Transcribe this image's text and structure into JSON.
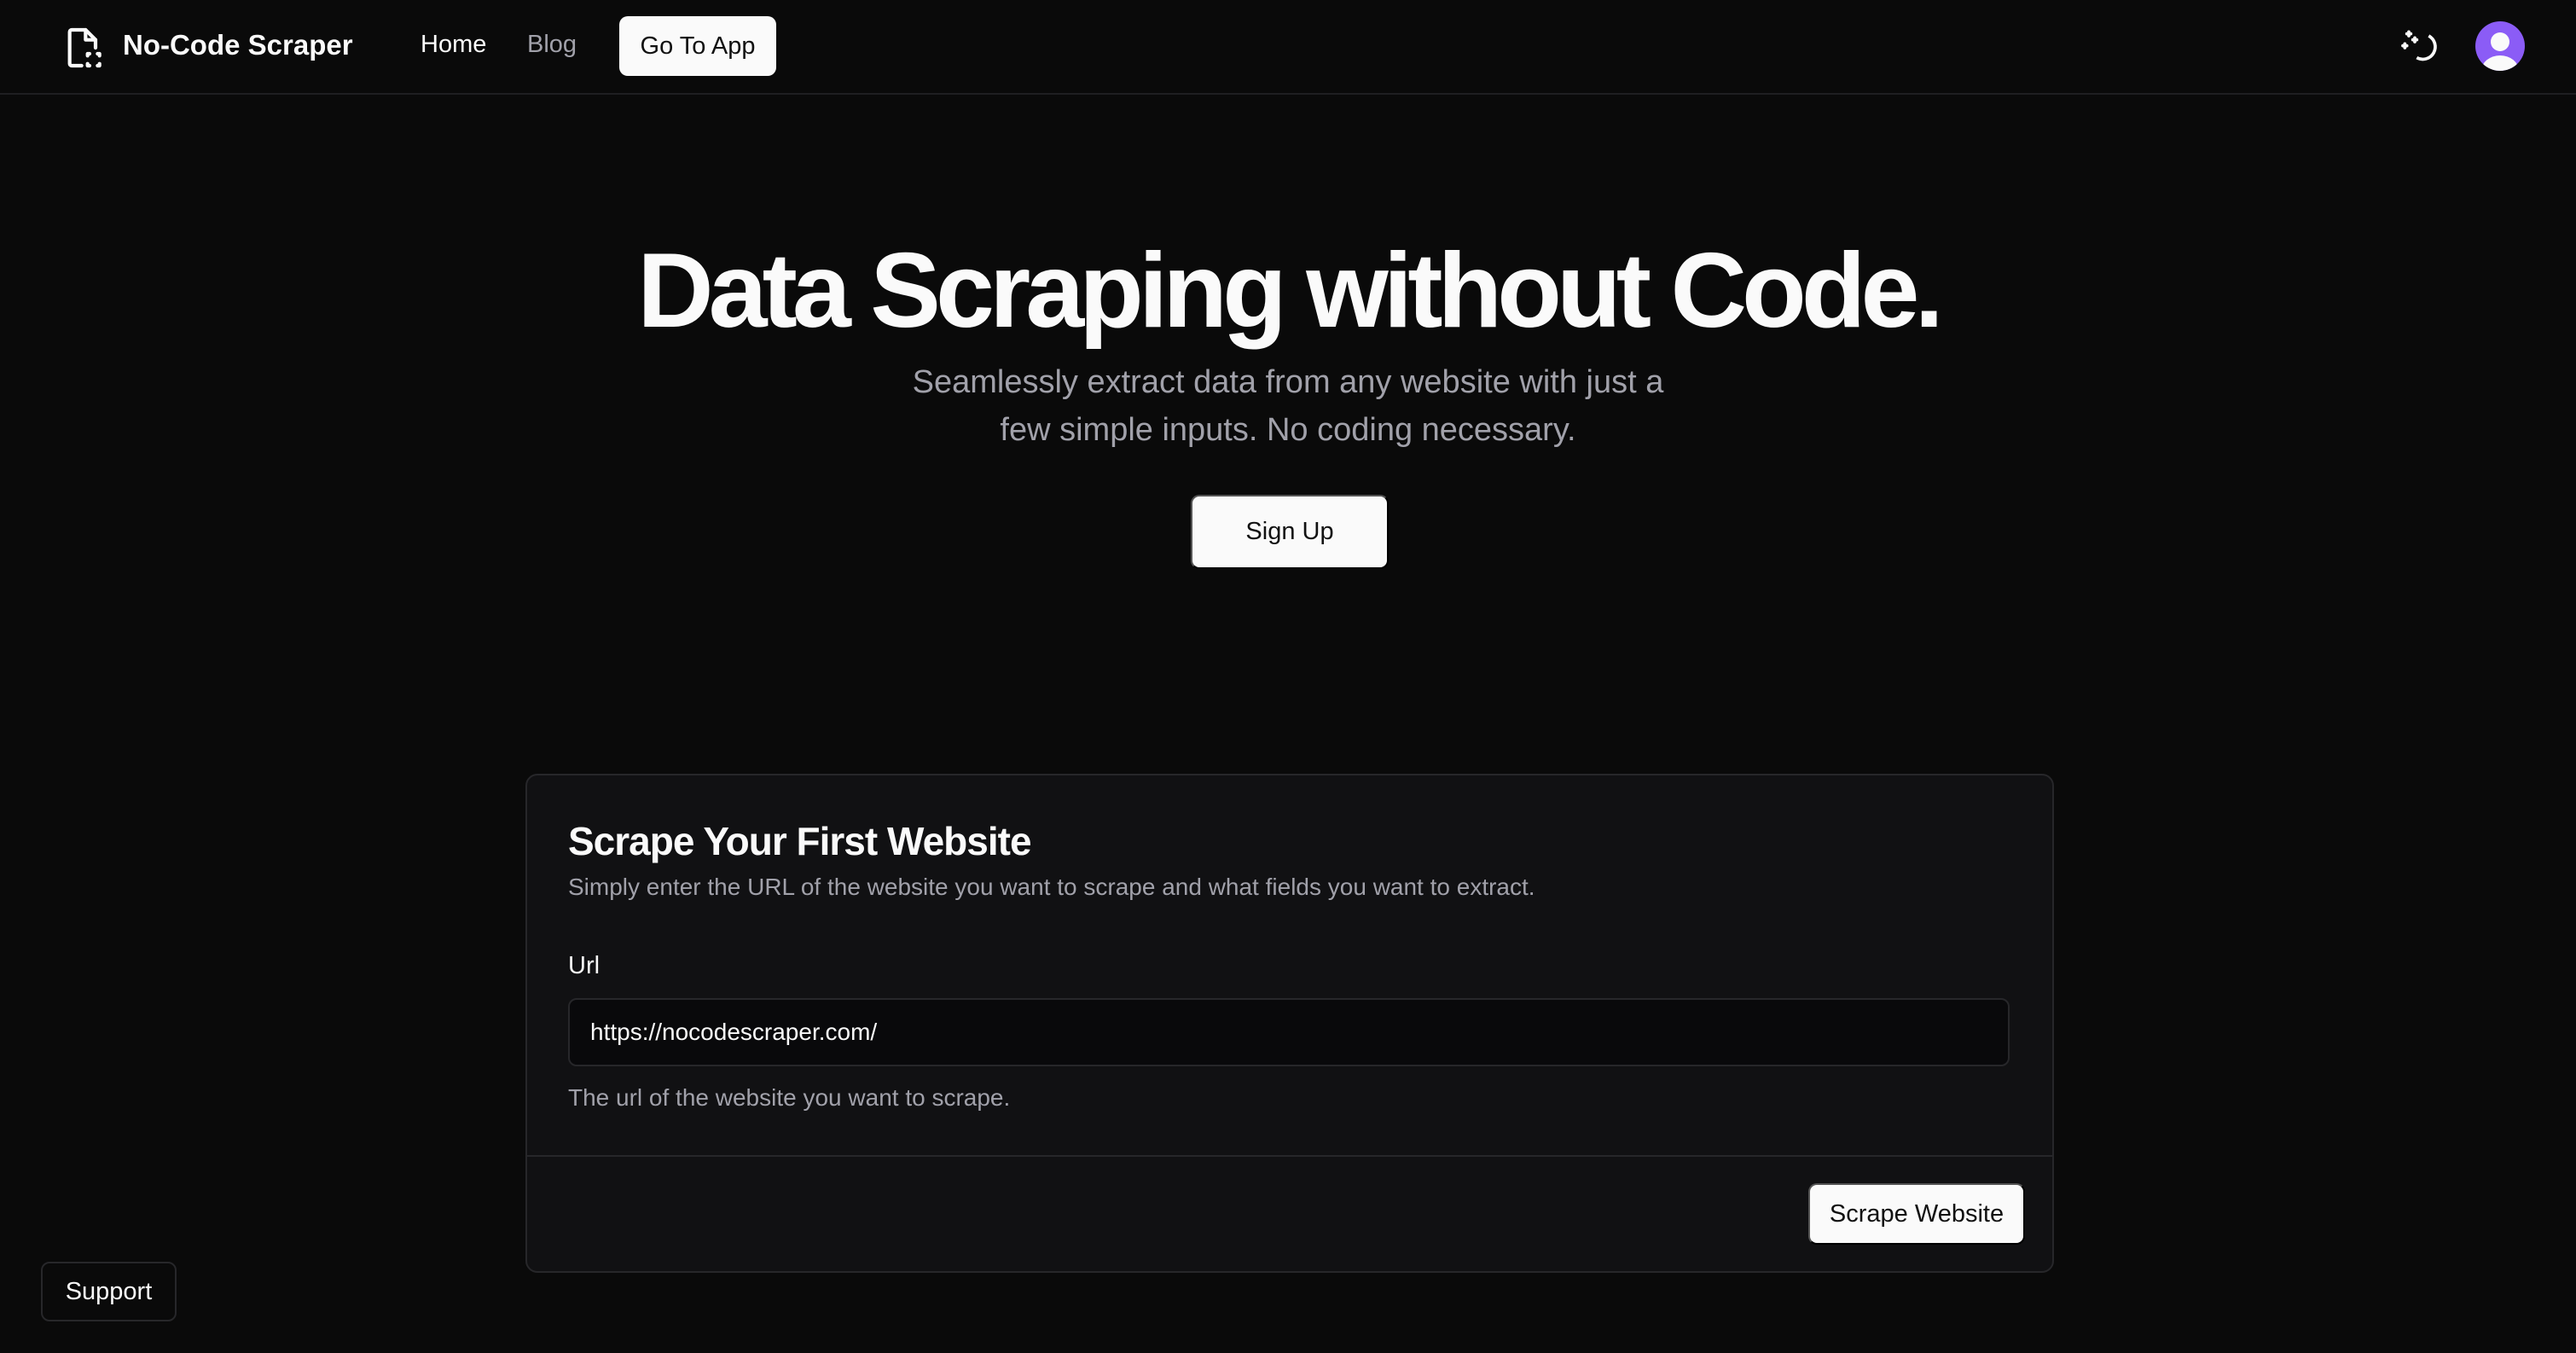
{
  "nav": {
    "brand": "No-Code Scraper",
    "links": [
      {
        "label": "Home"
      },
      {
        "label": "Blog"
      }
    ],
    "cta_label": "Go To App",
    "avatar_color": "#8b5cf6",
    "icons": [
      "file-scan-icon",
      "theme-moon-icon",
      "user-avatar-icon"
    ]
  },
  "hero": {
    "title": "Data Scraping without Code.",
    "subtitle": "Seamlessly extract data from any website with just a few simple inputs. No coding necessary.",
    "signup_label": "Sign Up"
  },
  "card": {
    "title": "Scrape Your First Website",
    "description": "Simply enter the URL of the website you want to scrape and what fields you want to extract.",
    "url_label": "Url",
    "url_value": "https://nocodescraper.com/",
    "url_helper": "The url of the website you want to scrape.",
    "submit_label": "Scrape Website"
  },
  "support_label": "Support"
}
